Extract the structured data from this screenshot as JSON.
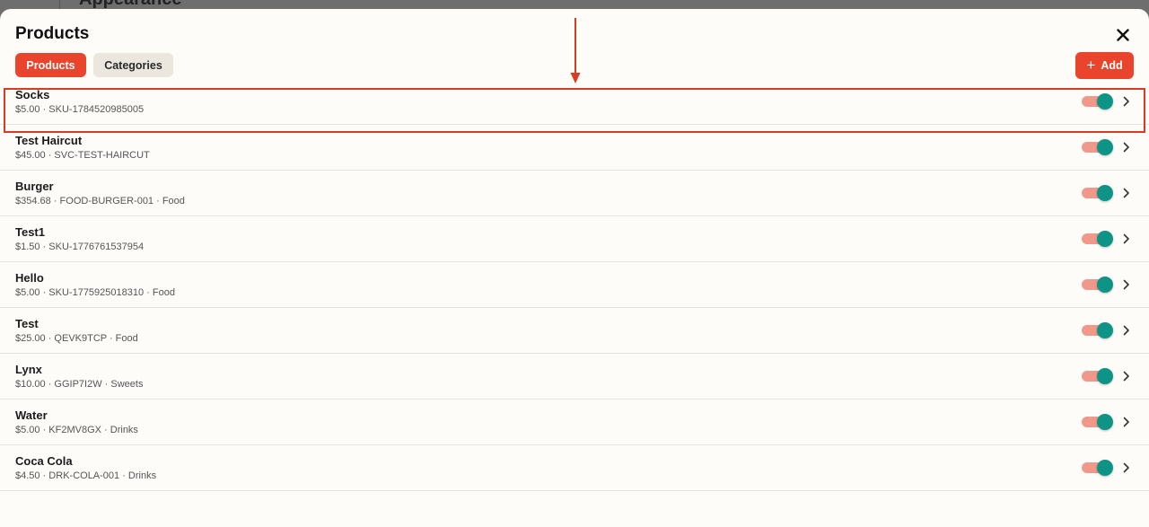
{
  "backdrop": {
    "title": "Appearance"
  },
  "header": {
    "title": "Products"
  },
  "tabs": [
    {
      "label": "Products",
      "active": true
    },
    {
      "label": "Categories",
      "active": false
    }
  ],
  "toolbar": {
    "add_label": "Add"
  },
  "colors": {
    "accent": "#e9442c",
    "toggle_on": "#0e9486",
    "toggle_track": "#f0988a",
    "annotation": "#d93a22"
  },
  "icons": {
    "close": "close-icon",
    "add": "plus-icon",
    "row_action": "chevron-right-icon"
  },
  "products": [
    {
      "name": "Socks",
      "details": "$5.00 · SKU-1784520985005",
      "enabled": true,
      "highlighted": true
    },
    {
      "name": "Test Haircut",
      "details": "$45.00 · SVC-TEST-HAIRCUT",
      "enabled": true
    },
    {
      "name": "Burger",
      "details": "$354.68 · FOOD-BURGER-001 · Food",
      "enabled": true
    },
    {
      "name": "Test1",
      "details": "$1.50 · SKU-1776761537954",
      "enabled": true
    },
    {
      "name": "Hello",
      "details": "$5.00 · SKU-1775925018310 · Food",
      "enabled": true
    },
    {
      "name": "Test",
      "details": "$25.00 · QEVK9TCP · Food",
      "enabled": true
    },
    {
      "name": "Lynx",
      "details": "$10.00 · GGIP7I2W · Sweets",
      "enabled": true
    },
    {
      "name": "Water",
      "details": "$5.00 · KF2MV8GX · Drinks",
      "enabled": true
    },
    {
      "name": "Coca Cola",
      "details": "$4.50 · DRK-COLA-001 · Drinks",
      "enabled": true
    }
  ]
}
